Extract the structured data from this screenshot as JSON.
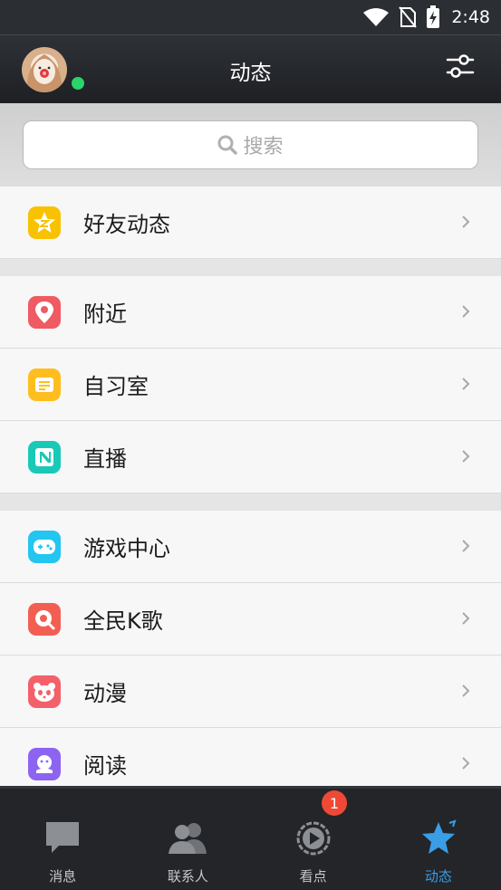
{
  "status": {
    "time": "2:48"
  },
  "header": {
    "title": "动态"
  },
  "search": {
    "placeholder": "搜索"
  },
  "menu": {
    "groups": [
      [
        {
          "label": "好友动态",
          "icon": "qzone-star-icon",
          "color": "#f8c200"
        }
      ],
      [
        {
          "label": "附近",
          "icon": "location-pin-icon",
          "color": "#ef5a63"
        },
        {
          "label": "自习室",
          "icon": "study-room-icon",
          "color": "#ffbe1f"
        },
        {
          "label": "直播",
          "icon": "live-icon",
          "color": "#19c9b7"
        }
      ],
      [
        {
          "label": "游戏中心",
          "icon": "gamepad-icon",
          "color": "#22c6f0"
        },
        {
          "label": "全民K歌",
          "icon": "karaoke-icon",
          "color": "#f25f52"
        },
        {
          "label": "动漫",
          "icon": "anime-panda-icon",
          "color": "#f4606a"
        },
        {
          "label": "阅读",
          "icon": "reading-icon",
          "color": "#8d64f2"
        }
      ]
    ]
  },
  "bottom_nav": {
    "tabs": [
      {
        "label": "消息",
        "icon": "chat-bubble-icon"
      },
      {
        "label": "联系人",
        "icon": "contacts-icon"
      },
      {
        "label": "看点",
        "icon": "watch-play-icon",
        "badge": "1"
      },
      {
        "label": "动态",
        "icon": "star-icon",
        "active": true
      }
    ]
  },
  "colors": {
    "accent": "#3a9de6",
    "badge": "#ef4935",
    "online": "#2bd36b"
  }
}
